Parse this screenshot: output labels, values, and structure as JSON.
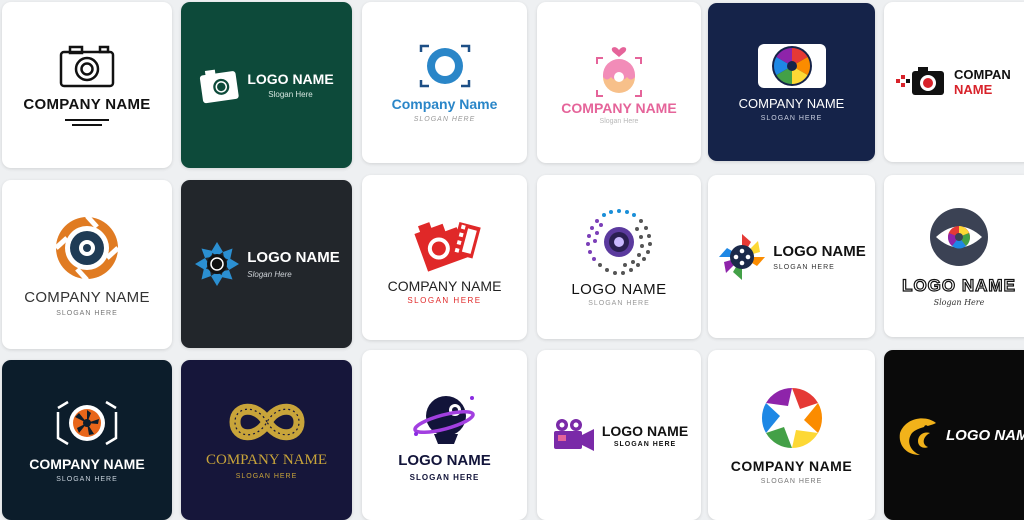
{
  "cards": [
    {
      "name": "COMPANY NAME",
      "bg": "#ffffff"
    },
    {
      "name": "LOGO NAME",
      "slogan": "Slogan Here",
      "bg": "#0d4a3a"
    },
    {
      "name": "Company Name",
      "slogan": "SLOGAN HERE",
      "bg": "#ffffff",
      "accent": "#2a86c8"
    },
    {
      "name": "COMPANY NAME",
      "slogan": "Slogan Here",
      "bg": "#ffffff",
      "accent": "#e5649a"
    },
    {
      "name": "COMPANY NAME",
      "slogan": "SLOGAN HERE",
      "bg": "#152349"
    },
    {
      "name": "COMPAN",
      "name2": "NAME",
      "bg": "#ffffff",
      "accent": "#d8222a"
    },
    {
      "name": "COMPANY NAME",
      "slogan": "SLOGAN HERE",
      "bg": "#ffffff",
      "accent": "#e07b22"
    },
    {
      "name": "LOGO NAME",
      "slogan": "Slogan Here",
      "bg": "#22262b",
      "accent": "#2b8fd1"
    },
    {
      "name": "COMPANY NAME",
      "slogan": "SLOGAN HERE",
      "bg": "#ffffff",
      "accent": "#e02828"
    },
    {
      "name": "LOGO NAME",
      "slogan": "SLOGAN HERE",
      "bg": "#ffffff"
    },
    {
      "name": "LOGO NAME",
      "slogan": "SLOGAN HERE",
      "bg": "#ffffff"
    },
    {
      "name": "LOGO NAME",
      "slogan": "Slogan Here",
      "bg": "#ffffff"
    },
    {
      "name": "COMPANY NAME",
      "slogan": "SLOGAN HERE",
      "bg": "#0c1d2b",
      "accent": "#e8661a"
    },
    {
      "name": "COMPANY NAME",
      "slogan": "SLOGAN HERE",
      "bg": "#16163a",
      "accent": "#c8a43a"
    },
    {
      "name": "LOGO NAME",
      "slogan": "SLOGAN HERE",
      "bg": "#ffffff",
      "accent": "#8a2be2"
    },
    {
      "name": "LOGO NAME",
      "slogan": "SLOGAN HERE",
      "bg": "#ffffff",
      "accent": "#7a2aa8"
    },
    {
      "name": "COMPANY NAME",
      "slogan": "SLOGAN HERE",
      "bg": "#ffffff"
    },
    {
      "name": "LOGO NAM",
      "bg": "#0a0a0a",
      "accent": "#f2b21a"
    }
  ]
}
